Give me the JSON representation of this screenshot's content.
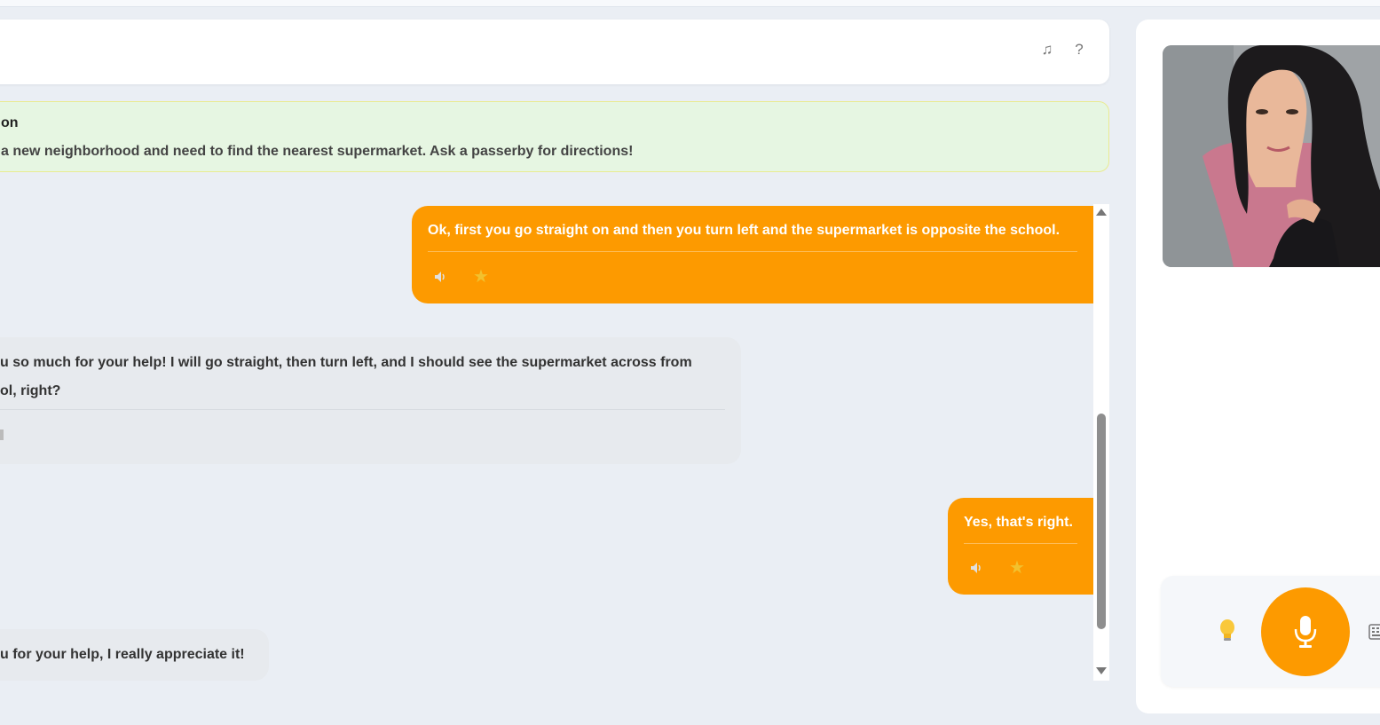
{
  "header": {
    "music_icon": "♫",
    "help_icon": "?"
  },
  "scenario": {
    "title": "on",
    "description": "a new neighborhood and need to find the nearest supermarket. Ask a passerby for directions!"
  },
  "messages": [
    {
      "role": "user",
      "text": "Ok, first you go straight on and then you turn left and the supermarket is opposite the school."
    },
    {
      "role": "ai",
      "line1": "u so much for your help! I will go straight, then turn left, and I should see the supermarket across from",
      "line2": "ol, right?"
    },
    {
      "role": "user",
      "text": "Yes, that's right."
    },
    {
      "role": "ai",
      "line1": "u for your help, I really appreciate it!"
    }
  ],
  "icons": {
    "speaker": "speaker-icon",
    "star": "★",
    "bulb": "lightbulb-icon",
    "mic": "microphone-icon",
    "keyboard": "keyboard-icon"
  },
  "colors": {
    "accent": "#fd9a00",
    "scenario_bg": "#e6f6e2",
    "scenario_border": "#e9eb92",
    "ai_bubble": "#e7eaee",
    "page_bg": "#eaeef4"
  }
}
